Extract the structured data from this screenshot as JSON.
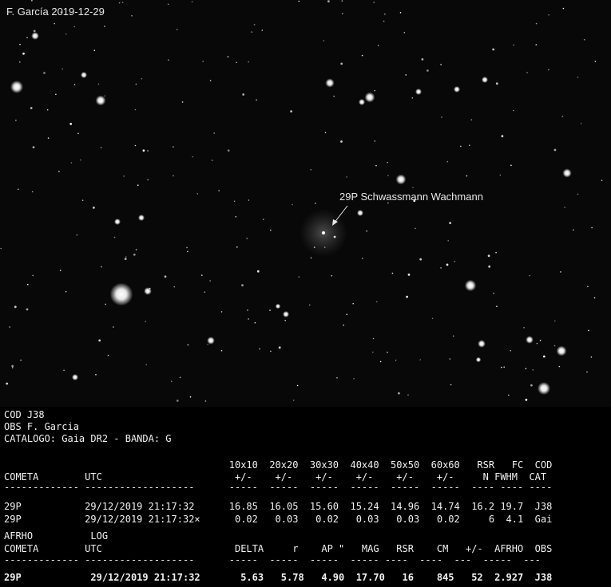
{
  "image": {
    "credit": "F. García  2019-12-29",
    "target_label": "29P Schwassmann Wachmann"
  },
  "report": {
    "header": [
      "COD J38",
      "OBS F. Garcia",
      "CATALOGO: Gaia DR2 - BANDA: G"
    ],
    "table1": [
      "                                       10x10  20x20  30x30  40x40  50x50  60x60   RSR   FC  COD",
      "COMETA        UTC                       +/-    +/-    +/-    +/-    +/-    +/-     N FWHM  CAT",
      "------------- -------------------      -----  -----  -----  -----  -----  -----  ---- ---- ----",
      "",
      "29P           29/12/2019 21:17:32      16.85  16.05  15.60  15.24  14.96  14.74  16.2 19.7  J38",
      "29P           29/12/2019 21:17:32×      0.02   0.03   0.02   0.03   0.03   0.02     6  4.1  Gai"
    ],
    "table2": [
      "AFRHO          LOG",
      "COMETA        UTC                       DELTA     r    AP \"   MAG   RSR    CM   +/-  AFRHO  OBS",
      "------------- -------------------      -----  -----  -----  ----- ----  ----  ---  -----  ---",
      "",
      "29P            29/12/2019 21:17:32       5.63   5.78   4.90  17.70   16    845   52  2.927  J38"
    ]
  }
}
